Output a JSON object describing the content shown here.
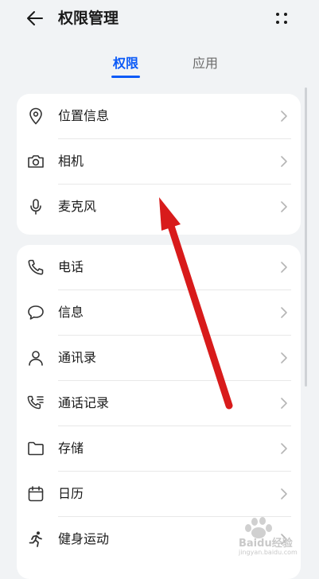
{
  "header": {
    "title": "权限管理",
    "back_icon": "back-arrow-icon",
    "more_icon": "more-dots-icon"
  },
  "tabs": [
    {
      "label": "权限",
      "active": true
    },
    {
      "label": "应用",
      "active": false
    }
  ],
  "groups": [
    {
      "items": [
        {
          "label": "位置信息",
          "icon": "location-pin-icon"
        },
        {
          "label": "相机",
          "icon": "camera-icon"
        },
        {
          "label": "麦克风",
          "icon": "microphone-icon"
        }
      ]
    },
    {
      "items": [
        {
          "label": "电话",
          "icon": "phone-icon"
        },
        {
          "label": "信息",
          "icon": "message-bubble-icon"
        },
        {
          "label": "通讯录",
          "icon": "contact-person-icon"
        },
        {
          "label": "通话记录",
          "icon": "call-log-icon"
        },
        {
          "label": "存储",
          "icon": "folder-icon"
        },
        {
          "label": "日历",
          "icon": "calendar-icon"
        },
        {
          "label": "健身运动",
          "icon": "running-icon"
        }
      ]
    }
  ],
  "colors": {
    "accent": "#0a59f7",
    "background": "#f1f3f5",
    "card": "#ffffff",
    "annotation_arrow": "#d81b1b"
  },
  "watermark": {
    "text": "Baidu经验",
    "sub": "jingyan.baidu.com"
  }
}
